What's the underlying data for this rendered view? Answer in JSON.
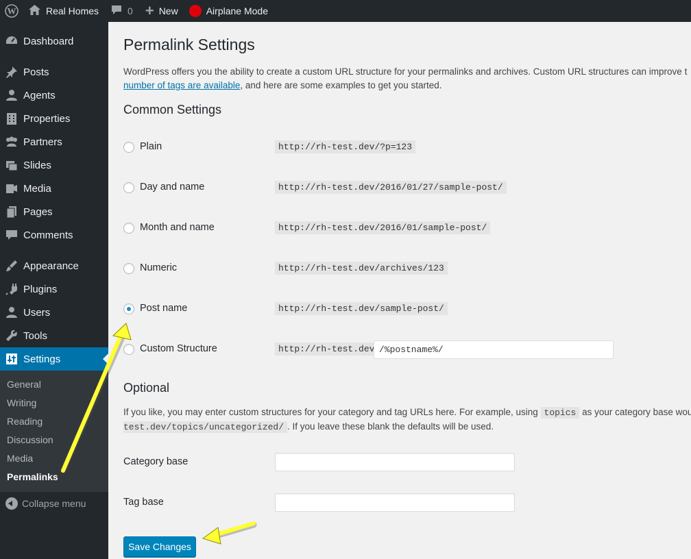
{
  "adminbar": {
    "site_name": "Real Homes",
    "comments_count": "0",
    "new_label": "New",
    "airplane_label": "Airplane Mode"
  },
  "sidebar": {
    "items": [
      {
        "label": "Dashboard",
        "icon": "dashboard-icon"
      },
      {
        "label": "Posts",
        "icon": "pin-icon"
      },
      {
        "label": "Agents",
        "icon": "person-icon"
      },
      {
        "label": "Properties",
        "icon": "building-icon"
      },
      {
        "label": "Partners",
        "icon": "group-icon"
      },
      {
        "label": "Slides",
        "icon": "images-icon"
      },
      {
        "label": "Media",
        "icon": "media-icon"
      },
      {
        "label": "Pages",
        "icon": "pages-icon"
      },
      {
        "label": "Comments",
        "icon": "comment-icon"
      },
      {
        "label": "Appearance",
        "icon": "brush-icon"
      },
      {
        "label": "Plugins",
        "icon": "plugin-icon"
      },
      {
        "label": "Users",
        "icon": "user-icon"
      },
      {
        "label": "Tools",
        "icon": "wrench-icon"
      },
      {
        "label": "Settings",
        "icon": "settings-icon"
      }
    ],
    "submenu": [
      "General",
      "Writing",
      "Reading",
      "Discussion",
      "Media",
      "Permalinks"
    ],
    "collapse_label": "Collapse menu"
  },
  "main": {
    "title": "Permalink Settings",
    "intro_text": "WordPress offers you the ability to create a custom URL structure for your permalinks and archives. Custom URL structures can improve t",
    "intro_link": "number of tags are available",
    "intro_text2": ", and here are some examples to get you started.",
    "common_heading": "Common Settings",
    "options": [
      {
        "label": "Plain",
        "example": "http://rh-test.dev/?p=123",
        "checked": false
      },
      {
        "label": "Day and name",
        "example": "http://rh-test.dev/2016/01/27/sample-post/",
        "checked": false
      },
      {
        "label": "Month and name",
        "example": "http://rh-test.dev/2016/01/sample-post/",
        "checked": false
      },
      {
        "label": "Numeric",
        "example": "http://rh-test.dev/archives/123",
        "checked": false
      },
      {
        "label": "Post name",
        "example": "http://rh-test.dev/sample-post/",
        "checked": true
      },
      {
        "label": "Custom Structure",
        "example": "http://rh-test.dev",
        "checked": false
      }
    ],
    "custom_value": "/%postname%/",
    "optional_heading": "Optional",
    "optional_text1": "If you like, you may enter custom structures for your category and tag URLs here. For example, using ",
    "optional_code1": "topics",
    "optional_text2": " as your category base wou",
    "optional_code2": "test.dev/topics/uncategorized/",
    "optional_text3": ". If you leave these blank the defaults will be used.",
    "category_base_label": "Category base",
    "category_base_value": "",
    "tag_base_label": "Tag base",
    "tag_base_value": "",
    "save_label": "Save Changes"
  },
  "colors": {
    "adminbar_bg": "#23282d",
    "sidebar_active": "#0073aa",
    "button": "#0085ba",
    "annotation_arrow": "#ffff33"
  }
}
